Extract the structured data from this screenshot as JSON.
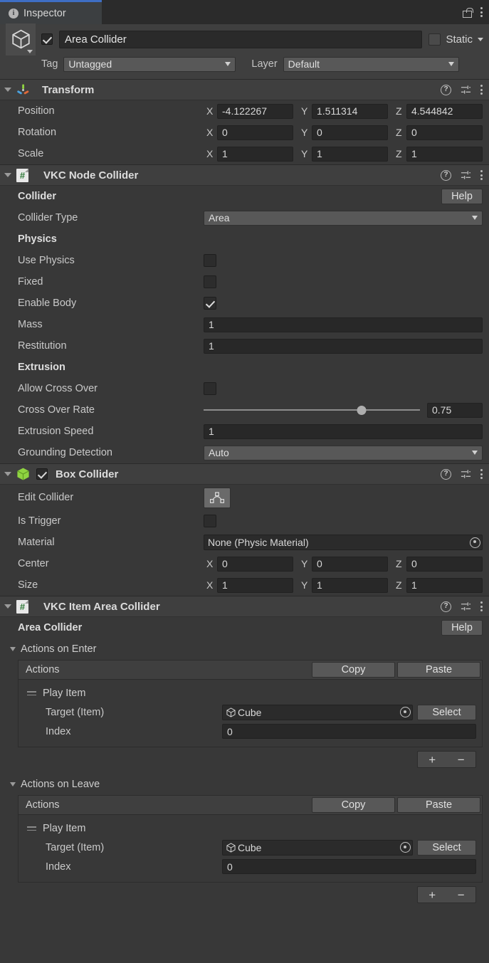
{
  "window": {
    "tab_label": "Inspector",
    "tab_icon": "info-icon",
    "lock_icon": "lock-open-icon",
    "menu_icon": "kebab-menu-icon",
    "accent_color": "#3e6ec4"
  },
  "object_header": {
    "enabled": true,
    "name": "Area Collider",
    "static_label": "Static",
    "static_checked": false,
    "tag_label": "Tag",
    "tag_value": "Untagged",
    "layer_label": "Layer",
    "layer_value": "Default",
    "prefab_icon": "cube-outline-icon"
  },
  "components": [
    {
      "id": "transform",
      "title": "Transform",
      "icon": "transform-gizmo-icon",
      "expanded": true,
      "has_enable_checkbox": false,
      "rows": [
        {
          "type": "vector3",
          "label": "Position",
          "x": "-4.122267",
          "y": "1.511314",
          "z": "4.544842"
        },
        {
          "type": "vector3",
          "label": "Rotation",
          "x": "0",
          "y": "0",
          "z": "0"
        },
        {
          "type": "vector3",
          "label": "Scale",
          "x": "1",
          "y": "1",
          "z": "1"
        }
      ]
    },
    {
      "id": "vkc-node-collider",
      "title": "VKC Node Collider",
      "icon": "csharp-script-icon",
      "expanded": true,
      "has_enable_checkbox": false,
      "section_header": {
        "label": "Collider",
        "help_label": "Help"
      },
      "rows": [
        {
          "type": "dropdown",
          "label": "Collider Type",
          "value": "Area"
        },
        {
          "type": "header",
          "label": "Physics"
        },
        {
          "type": "checkbox",
          "label": "Use Physics",
          "checked": false
        },
        {
          "type": "checkbox",
          "label": "Fixed",
          "checked": false
        },
        {
          "type": "checkbox",
          "label": "Enable Body",
          "checked": true
        },
        {
          "type": "text",
          "label": "Mass",
          "value": "1"
        },
        {
          "type": "text",
          "label": "Restitution",
          "value": "1"
        },
        {
          "type": "header",
          "label": "Extrusion"
        },
        {
          "type": "checkbox",
          "label": "Allow Cross Over",
          "checked": false
        },
        {
          "type": "slider",
          "label": "Cross Over Rate",
          "value": "0.75",
          "percent": 73
        },
        {
          "type": "text",
          "label": "Extrusion Speed",
          "value": "1"
        },
        {
          "type": "dropdown",
          "label": "Grounding Detection",
          "value": "Auto"
        }
      ]
    },
    {
      "id": "box-collider",
      "title": "Box Collider",
      "icon": "box-collider-icon",
      "expanded": true,
      "has_enable_checkbox": true,
      "enabled": true,
      "rows": [
        {
          "type": "edit-collider",
          "label": "Edit Collider",
          "icon": "edit-collider-icon"
        },
        {
          "type": "checkbox",
          "label": "Is Trigger",
          "checked": false
        },
        {
          "type": "object",
          "label": "Material",
          "value": "None (Physic Material)"
        },
        {
          "type": "vector3",
          "label": "Center",
          "x": "0",
          "y": "0",
          "z": "0"
        },
        {
          "type": "vector3",
          "label": "Size",
          "x": "1",
          "y": "1",
          "z": "1"
        }
      ]
    }
  ],
  "area_collider_component": {
    "title": "VKC Item Area Collider",
    "icon": "csharp-script-icon",
    "expanded": true,
    "section_header": {
      "label": "Area Collider",
      "help_label": "Help"
    },
    "groups": [
      {
        "id": "actions-on-enter",
        "foldout_label": "Actions on Enter",
        "expanded": true,
        "list_label": "Actions",
        "copy_label": "Copy",
        "paste_label": "Paste",
        "elements": [
          {
            "title": "Play Item",
            "drag_handle_icon": "drag-handle-icon",
            "fields": [
              {
                "type": "object",
                "label": "Target (Item)",
                "value": "Cube",
                "icon": "cube-outline-icon",
                "button_label": "Select"
              },
              {
                "type": "text",
                "label": "Index",
                "value": "0"
              }
            ]
          }
        ],
        "add_label": "+",
        "remove_label": "−"
      },
      {
        "id": "actions-on-leave",
        "foldout_label": "Actions on Leave",
        "expanded": true,
        "list_label": "Actions",
        "copy_label": "Copy",
        "paste_label": "Paste",
        "elements": [
          {
            "title": "Play Item",
            "drag_handle_icon": "drag-handle-icon",
            "fields": [
              {
                "type": "object",
                "label": "Target (Item)",
                "value": "Cube",
                "icon": "cube-outline-icon",
                "button_label": "Select"
              },
              {
                "type": "text",
                "label": "Index",
                "value": "0"
              }
            ]
          }
        ],
        "add_label": "+",
        "remove_label": "−"
      }
    ]
  },
  "axis_labels": {
    "x": "X",
    "y": "Y",
    "z": "Z"
  }
}
